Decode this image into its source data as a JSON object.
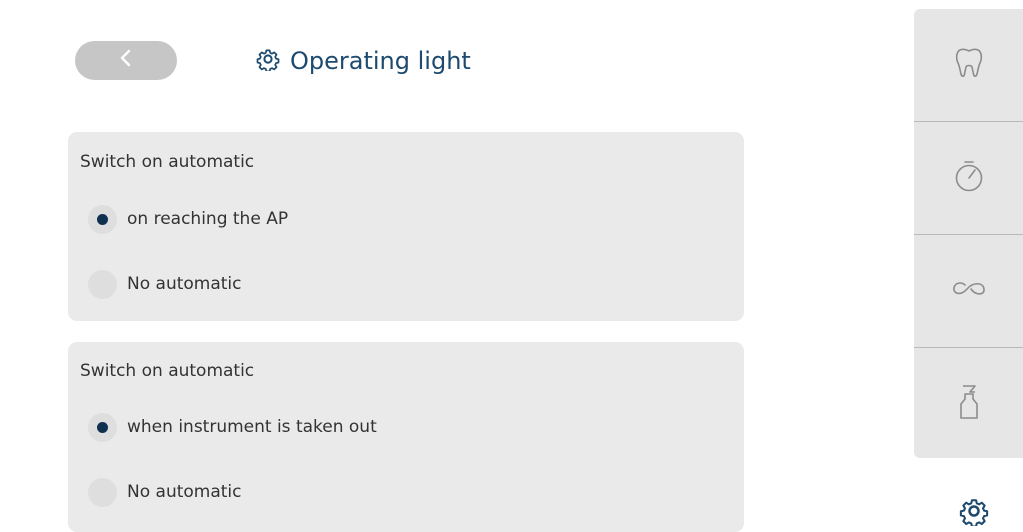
{
  "header": {
    "back_icon": "chevron-left-icon",
    "title_icon": "gear-icon",
    "title": "Operating light"
  },
  "panels": [
    {
      "heading": "Switch on automatic",
      "options": [
        {
          "label": "on reaching the AP",
          "selected": true
        },
        {
          "label": "No automatic",
          "selected": false
        }
      ]
    },
    {
      "heading": "Switch on automatic",
      "options": [
        {
          "label": "when instrument is taken out",
          "selected": true
        },
        {
          "label": "No automatic",
          "selected": false
        }
      ]
    }
  ],
  "sidebar": {
    "items": [
      {
        "icon": "tooth-icon"
      },
      {
        "icon": "stopwatch-icon"
      },
      {
        "icon": "infinity-icon"
      },
      {
        "icon": "spray-bottle-icon"
      }
    ],
    "active_item_icon": "gear-icon"
  },
  "colors": {
    "accent": "#1d4a6e",
    "radio_selected": "#0e3150",
    "panel_background": "#eaeaea",
    "sidebar_background": "#e6e6e6",
    "back_button": "#c6c6c6",
    "sidebar_icon": "#8c8c8c"
  }
}
